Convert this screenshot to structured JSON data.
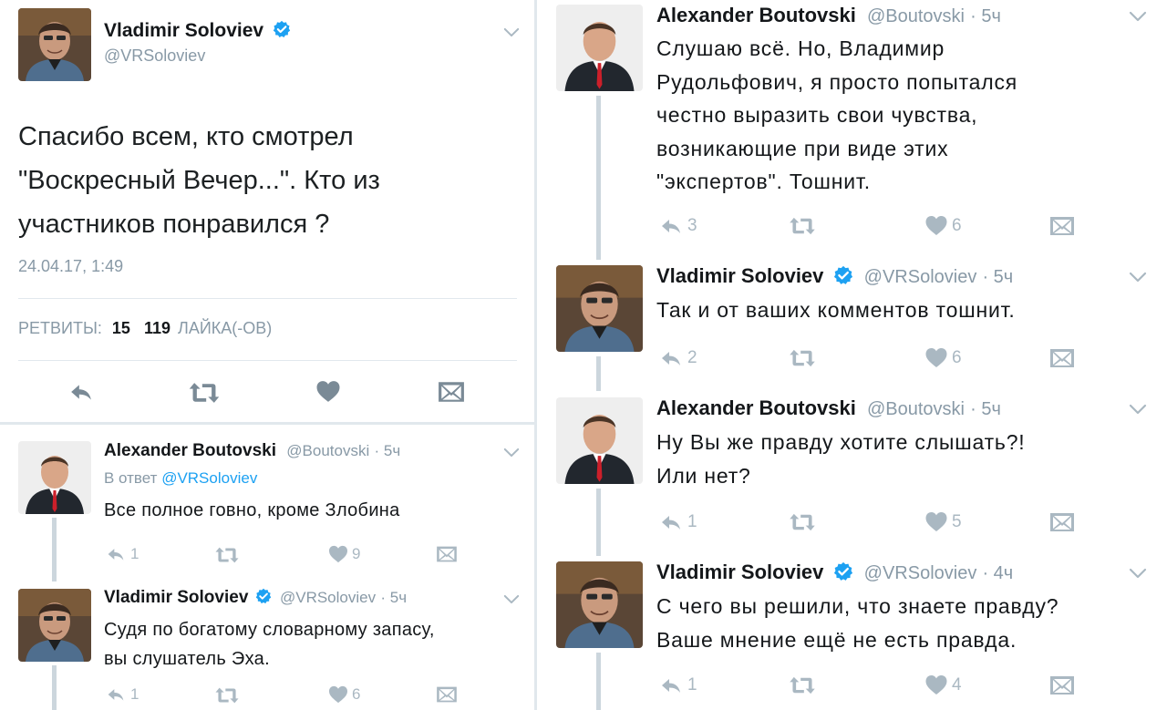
{
  "main_tweet": {
    "author_name": "Vladimir Soloviev",
    "author_handle": "@VRSoloviev",
    "text_line_1": "Спасибо всем, кто смотрел",
    "text_line_2": "\"Воскресный Вечер...\". Кто из",
    "text_line_3": "участников понравился ?",
    "timestamp": "24.04.17, 1:49",
    "retweets_label": "РЕТВИТЫ:",
    "retweets_count": "15",
    "likes_count": "119",
    "likes_label": "ЛАЙКА(-ОВ)"
  },
  "left_replies": [
    {
      "author_name": "Alexander Boutovski",
      "author_handle": "@Boutovski",
      "time": "· 5ч",
      "reply_to_prefix": "В ответ",
      "reply_to_handle": "@VRSoloviev",
      "text_line_1": "Все полное говно, кроме Злобина",
      "reply_count": "1",
      "like_count": "9"
    },
    {
      "author_name": "Vladimir Soloviev",
      "author_handle": "@VRSoloviev",
      "time": "· 5ч",
      "text_line_1": "Судя по богатому словарному запасу,",
      "text_line_2": "вы слушатель Эха.",
      "reply_count": "1",
      "like_count": "6"
    }
  ],
  "right_replies": [
    {
      "author_name": "Alexander Boutovski",
      "author_handle": "@Boutovski",
      "time": "· 5ч",
      "text_line_1": "Слушаю всё. Но, Владимир",
      "text_line_2": "Рудольфович, я просто попытался",
      "text_line_3": "честно выразить свои чувства,",
      "text_line_4": "возникающие при виде этих",
      "text_line_5": "\"экспертов\". Тошнит.",
      "reply_count": "3",
      "like_count": "6"
    },
    {
      "author_name": "Vladimir Soloviev",
      "author_handle": "@VRSoloviev",
      "time": "· 5ч",
      "text_line_1": "Так и от ваших комментов тошнит.",
      "reply_count": "2",
      "like_count": "6"
    },
    {
      "author_name": "Alexander Boutovski",
      "author_handle": "@Boutovski",
      "time": "· 5ч",
      "text_line_1": "Ну Вы же правду хотите слышать?!",
      "text_line_2": "Или нет?",
      "reply_count": "1",
      "like_count": "5"
    },
    {
      "author_name": "Vladimir Soloviev",
      "author_handle": "@VRSoloviev",
      "time": "· 4ч",
      "text_line_1": "С чего вы решили, что знаете правду?",
      "text_line_2": "Ваше мнение ещё не есть правда.",
      "reply_count": "1",
      "like_count": "4"
    }
  ],
  "icons": {
    "reply": "reply-icon",
    "retweet": "retweet-icon",
    "like": "heart-icon",
    "dm": "envelope-icon",
    "verified": "verified-badge-icon",
    "menu": "chevron-down-icon"
  },
  "colors": {
    "verified_blue": "#1da1f2",
    "icon_gray": "#aab8c2",
    "handle_gray": "#8899a6",
    "thread_line": "#ccd6dd"
  }
}
